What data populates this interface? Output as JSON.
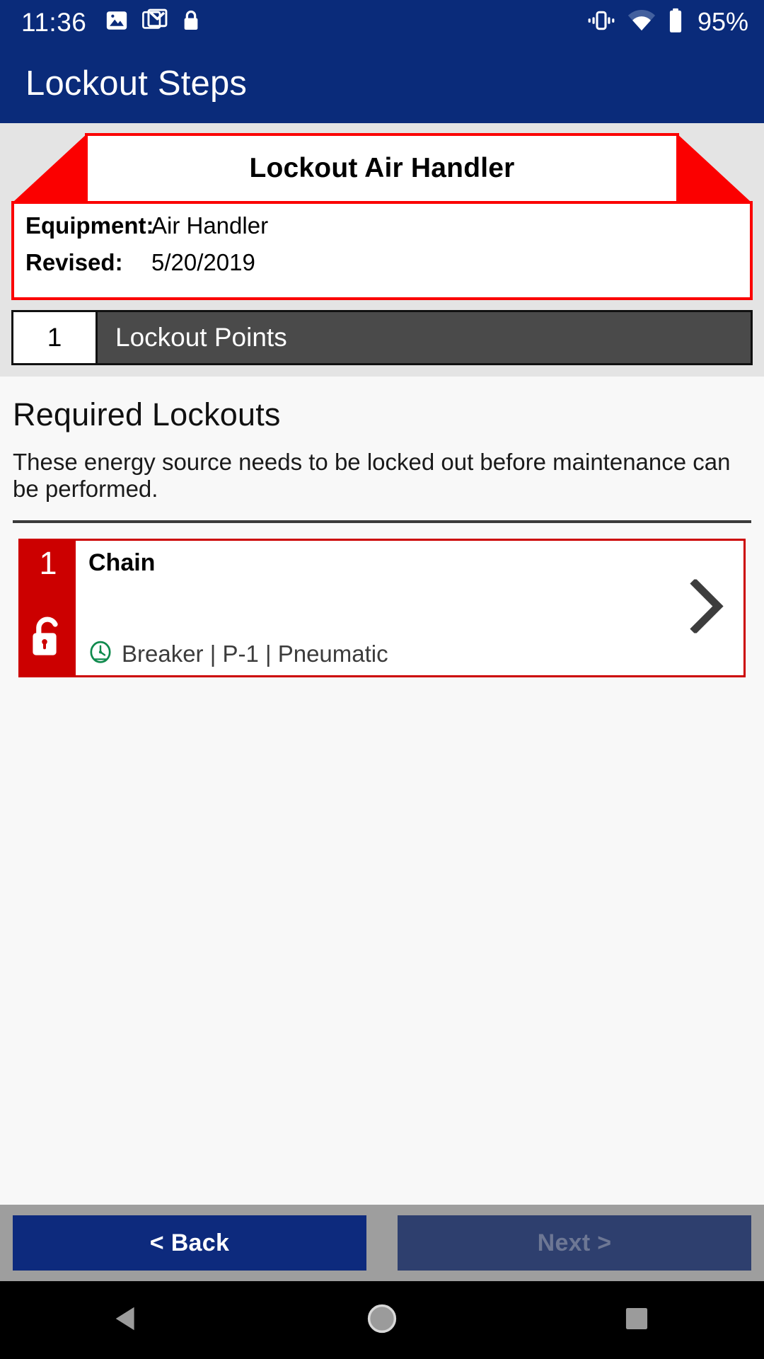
{
  "status_bar": {
    "time": "11:36",
    "left_icons": [
      "photos-icon",
      "gmail-icon",
      "lock-icon"
    ],
    "right_icons": [
      "vibrate-icon",
      "wifi-icon",
      "battery-icon"
    ],
    "battery_percent": "95%"
  },
  "app_bar": {
    "title": "Lockout Steps"
  },
  "header_panel": {
    "ribbon_title": "Lockout Air Handler",
    "info": [
      {
        "label": "Equipment:",
        "value": "Air Handler"
      },
      {
        "label": "Revised:",
        "value": "5/20/2019"
      }
    ],
    "points_bar": {
      "count": "1",
      "label": "Lockout Points"
    }
  },
  "main": {
    "section_title": "Required Lockouts",
    "section_description": "These energy source needs to be locked out before maintenance can be performed.",
    "lockouts": [
      {
        "number": "1",
        "name": "Chain",
        "meta": "Breaker | P-1 | Pneumatic",
        "meta_icon": "gauge-icon",
        "state_icon": "unlocked-padlock-icon",
        "chevron": "chevron-right-icon"
      }
    ]
  },
  "footer": {
    "back_label": "< Back",
    "next_label": "Next >"
  },
  "nav_bar": {
    "back": "triangle-back-icon",
    "home": "circle-home-icon",
    "recents": "square-recents-icon"
  },
  "colors": {
    "brand_blue": "#0a2b7a",
    "alert_red": "#fb0000",
    "card_red": "#cc0000",
    "points_gray": "#4a4a4a",
    "meta_green": "#0f8a4d"
  }
}
